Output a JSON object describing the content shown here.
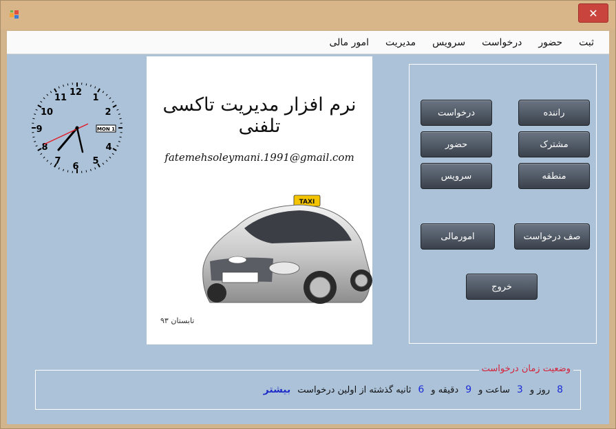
{
  "window": {
    "app_icon": "windows-form-icon",
    "close_glyph": "✕"
  },
  "menu": {
    "items": [
      "ثبت",
      "حضور",
      "درخواست",
      "سرویس",
      "مدیریت",
      "امور مالی"
    ]
  },
  "clock": {
    "numbers": [
      "12",
      "1",
      "2",
      "4",
      "5",
      "6",
      "7",
      "8",
      "9",
      "10",
      "11"
    ],
    "date_box": "MON 1"
  },
  "poster": {
    "title": "نرم افزار مدیریت تاکسی تلفنی",
    "email": "fatemehsoleymani.1991@gmail.com",
    "taxi_sign": "TAXI",
    "signature": "تابستان ۹۳"
  },
  "buttons": {
    "driver": "راننده",
    "request": "درخواست",
    "subscriber": "مشترک",
    "attendance": "حضور",
    "zone": "منطقه",
    "service": "سرویس",
    "request_queue": "صف درخواست",
    "finance": "امورمالی",
    "exit": "خروج"
  },
  "status": {
    "legend": "وضعیت زمان درخواست",
    "days": "8",
    "days_label": "روز و",
    "hours": "3",
    "hours_label": "ساعت و",
    "minutes": "9",
    "minutes_label": "دقیقه و",
    "seconds": "6",
    "seconds_label": "ثانیه گذشته از اولین درخواست",
    "more": "بیشتر"
  },
  "colors": {
    "window_frame": "#d2b48c",
    "client_bg": "#abc2d9",
    "close_button": "#c9443c",
    "button_dark": "#555e6b",
    "legend_red": "#d4233a",
    "number_blue": "#1c2cd6"
  }
}
